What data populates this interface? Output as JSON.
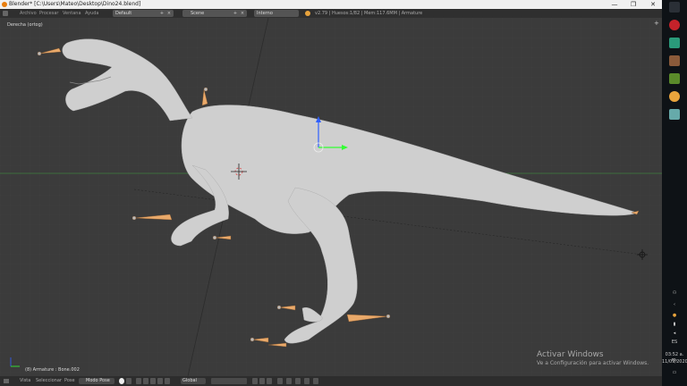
{
  "window": {
    "title": "Blender* [C:\\Users\\Mateo\\Desktop\\Dino24.blend]",
    "controls": [
      "—",
      "❐",
      "✕"
    ]
  },
  "menu": {
    "items": [
      "Archivo",
      "Procesar",
      "Ventana",
      "Ayuda"
    ],
    "layout": "Default",
    "scene_label": "Scene",
    "engine": "Interno",
    "stats": "v2.79 | Huesos:1/82 | Mem:117.6MM | Armature"
  },
  "viewport": {
    "view_label": "Derecha (ortog)",
    "object_label": "(8) Armature : Bone.002"
  },
  "footer": {
    "menus": [
      "Vista",
      "Seleccionar",
      "Pose"
    ],
    "mode": "Modo Pose",
    "orientation": "Global"
  },
  "watermark": {
    "title": "Activar Windows",
    "subtitle": "Ve a Configuración para activar Windows."
  },
  "taskbar": {
    "time": "03:52 a. m.",
    "date": "11/09/2020"
  },
  "colors": {
    "viewport_bg": "#3b3b3b",
    "model": "#cfcfcf",
    "bone": "#e9a96a",
    "axis_green": "#3f7f3f"
  }
}
